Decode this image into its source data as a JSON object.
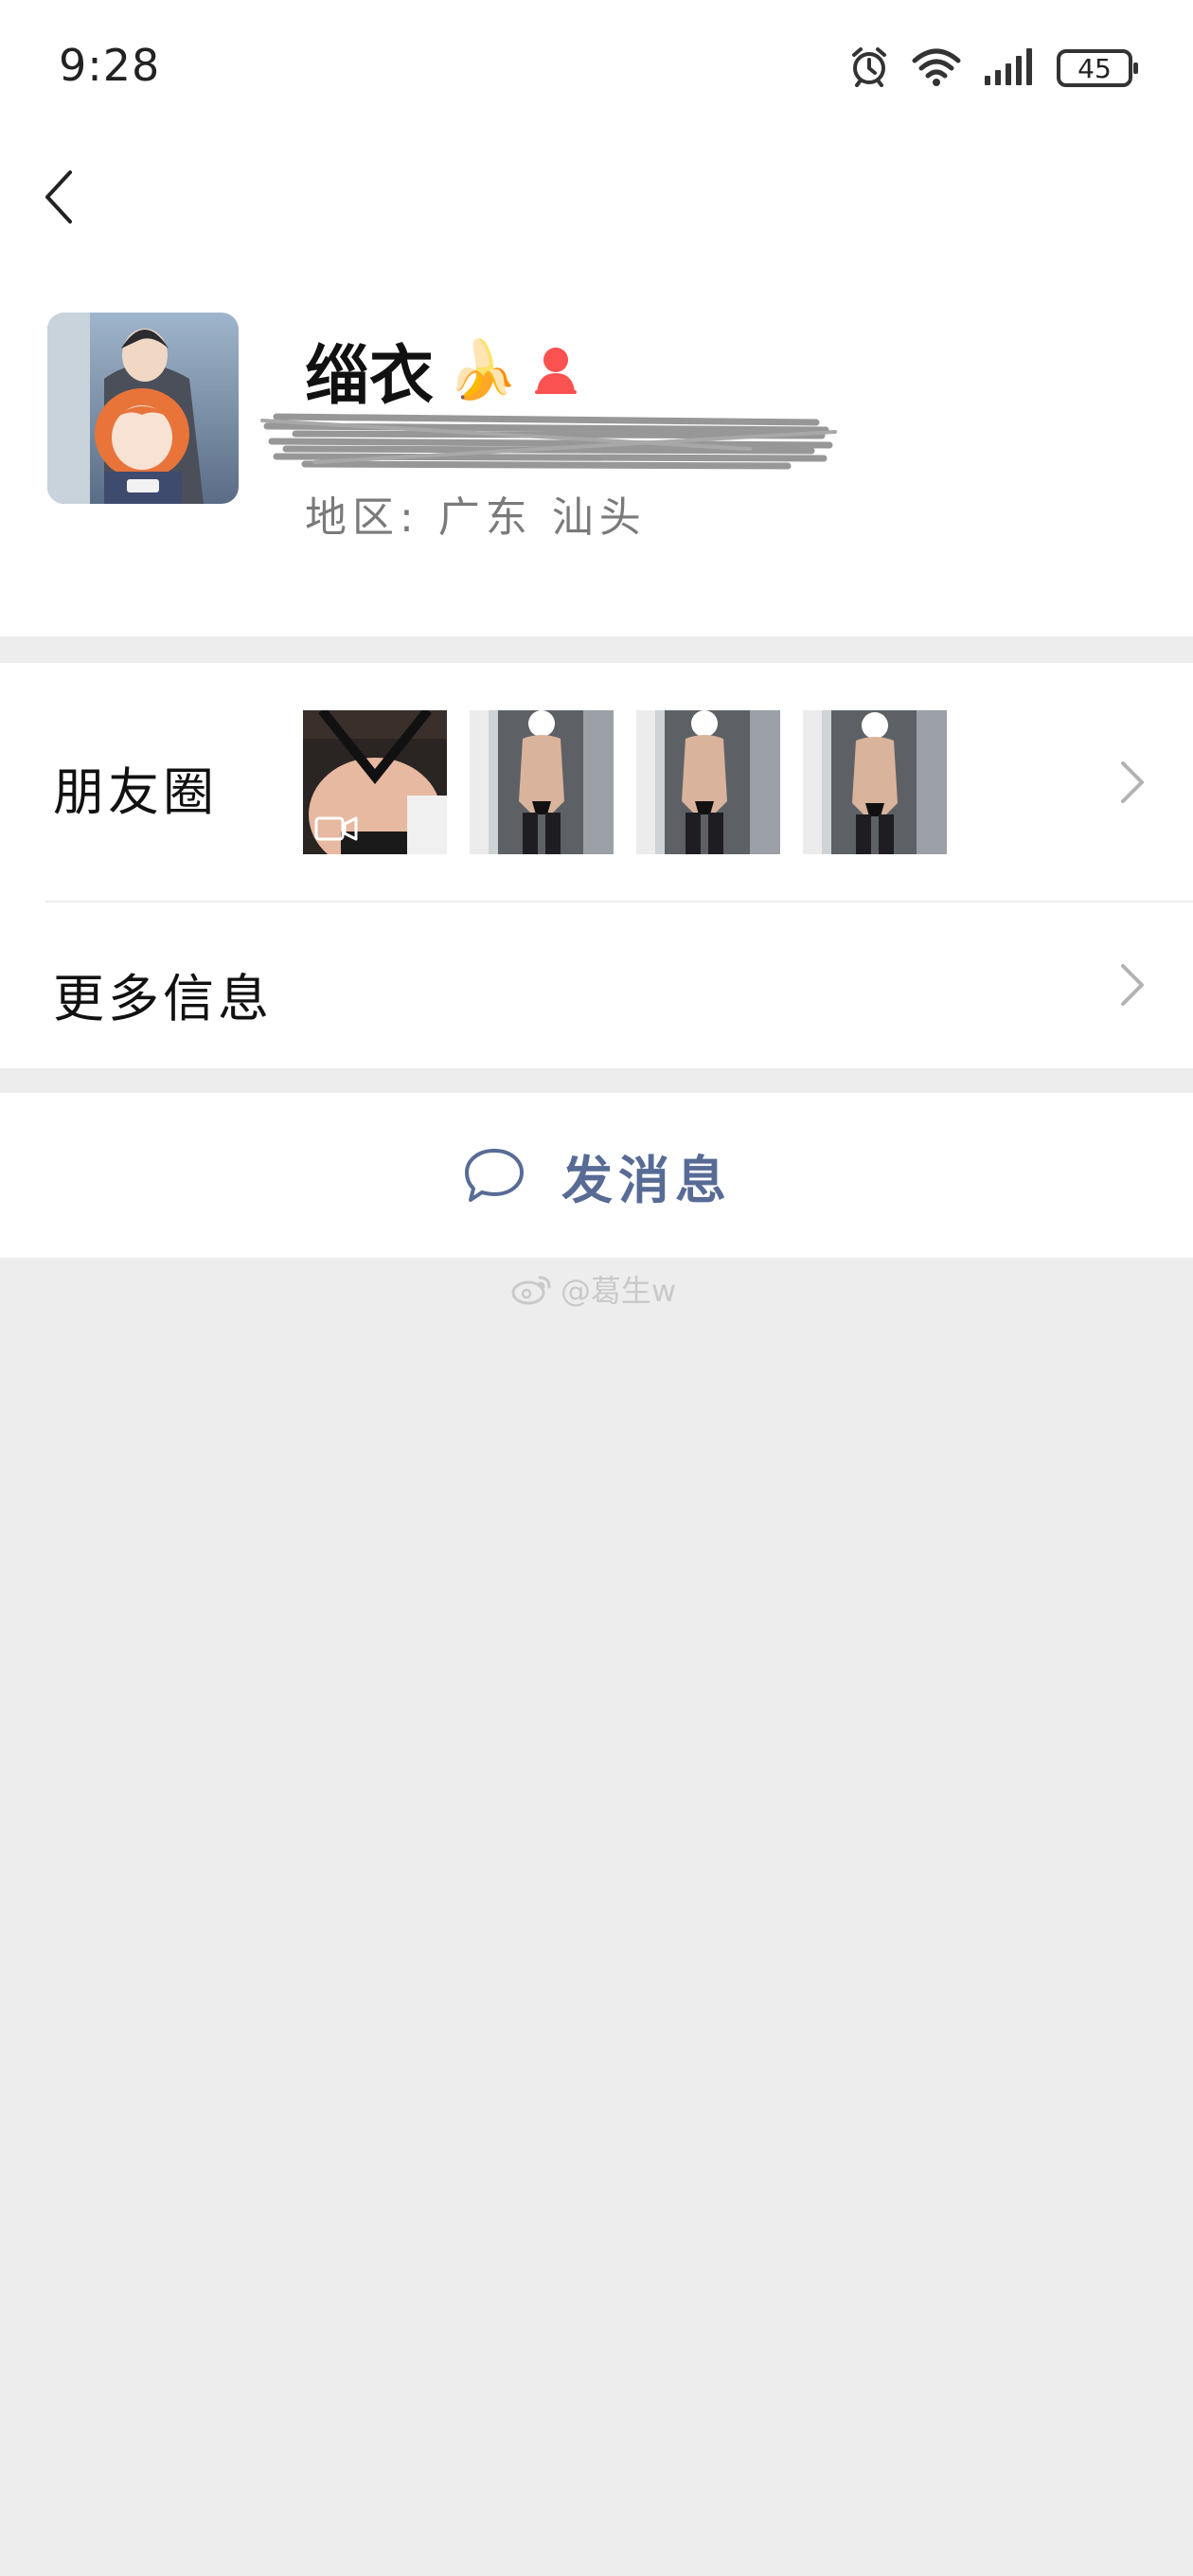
{
  "status_bar": {
    "time": "9:28",
    "battery_level": "45",
    "icons": [
      "alarm-icon",
      "wifi-icon",
      "signal-icon",
      "battery-icon"
    ]
  },
  "nav": {
    "back_icon": "chevron-left-icon"
  },
  "profile": {
    "nickname": "缁衣",
    "nickname_emoji": "🍌",
    "region": "地区:  广东  汕头",
    "gender_icon": "female-icon",
    "gender_color": "#fa5151"
  },
  "moments": {
    "label": "朋友圈",
    "thumbnail_count": 4,
    "first_is_video": true
  },
  "more_info": {
    "label": "更多信息"
  },
  "send_message": {
    "label": "发消息",
    "color": "#576b95",
    "icon": "chat-bubble-icon"
  },
  "watermark": {
    "text": "@葛生w",
    "icon": "weibo-icon"
  }
}
